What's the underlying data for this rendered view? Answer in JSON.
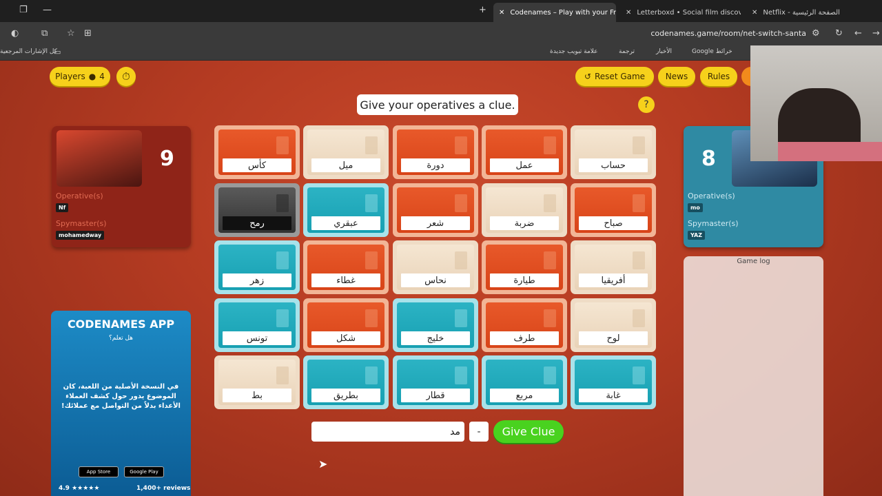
{
  "browser": {
    "tabs": [
      {
        "title": "Codenames – Play with your Fr",
        "active": true
      },
      {
        "title": "Letterboxd • Social film discove",
        "active": false
      },
      {
        "title": "Netflix - الصفحة الرئيسية",
        "active": false
      }
    ],
    "url": "codenames.game/room/net-switch-santa",
    "bookmarks": [
      "كل الإشارات المرجعية",
      "علامة تبويب جديدة",
      "ترجمة",
      "الأخبار",
      "خرائط Google"
    ]
  },
  "header": {
    "players_label": "Players",
    "players_count": "4",
    "reset_label": "Reset Game",
    "news_label": "News",
    "rules_label": "Rules",
    "instruction": "Give your operatives a clue.",
    "help": "?"
  },
  "red_team": {
    "score": "9",
    "operatives_label": "Operative(s)",
    "operative": "Nf",
    "spymaster_label": "Spymaster(s)",
    "spymaster": "mohamedway"
  },
  "blue_team": {
    "score": "8",
    "operatives_label": "Operative(s)",
    "operative": "mo",
    "spymaster_label": "Spymaster(s)",
    "spymaster": "YAZ"
  },
  "game_log_label": "Game log",
  "ad": {
    "title": "CODENAMES APP",
    "subtitle": "هل تعلم؟",
    "body": "في النسخة الأصلية من اللعبة، كان الموضوع يدور حول كشف العملاء الأعداء بدلاً من التواصل مع عملائك!",
    "appstore": "App Store",
    "googleplay": "Google Play",
    "rating": "4.9 ★★★★★",
    "reviews": "1,400+ reviews"
  },
  "board": {
    "cards": [
      {
        "word": "كأس",
        "type": "red"
      },
      {
        "word": "ميل",
        "type": "neutral"
      },
      {
        "word": "دورة",
        "type": "red"
      },
      {
        "word": "عمل",
        "type": "red"
      },
      {
        "word": "حساب",
        "type": "neutral"
      },
      {
        "word": "رمح",
        "type": "assassin"
      },
      {
        "word": "عبقري",
        "type": "blue"
      },
      {
        "word": "شعر",
        "type": "red"
      },
      {
        "word": "ضربة",
        "type": "neutral"
      },
      {
        "word": "صباح",
        "type": "red"
      },
      {
        "word": "زهر",
        "type": "blue"
      },
      {
        "word": "غطاء",
        "type": "red"
      },
      {
        "word": "نحاس",
        "type": "neutral"
      },
      {
        "word": "طيارة",
        "type": "red"
      },
      {
        "word": "أفريقيا",
        "type": "neutral"
      },
      {
        "word": "تونس",
        "type": "blue"
      },
      {
        "word": "شكل",
        "type": "red"
      },
      {
        "word": "خليج",
        "type": "blue"
      },
      {
        "word": "طرف",
        "type": "red"
      },
      {
        "word": "لوح",
        "type": "neutral"
      },
      {
        "word": "بط",
        "type": "neutral"
      },
      {
        "word": "بطريق",
        "type": "blue"
      },
      {
        "word": "قطار",
        "type": "blue"
      },
      {
        "word": "مربع",
        "type": "blue"
      },
      {
        "word": "غابة",
        "type": "blue"
      }
    ]
  },
  "clue": {
    "value": "مد",
    "number": "-",
    "give_label": "Give Clue"
  },
  "colors": {
    "red_card": "#e8592a",
    "blue_card": "#17a0b2",
    "neutral_card": "#f5e6d2",
    "assassin_card": "#333333",
    "accent_yellow": "#f6d11b",
    "give_green": "#49d21f"
  }
}
